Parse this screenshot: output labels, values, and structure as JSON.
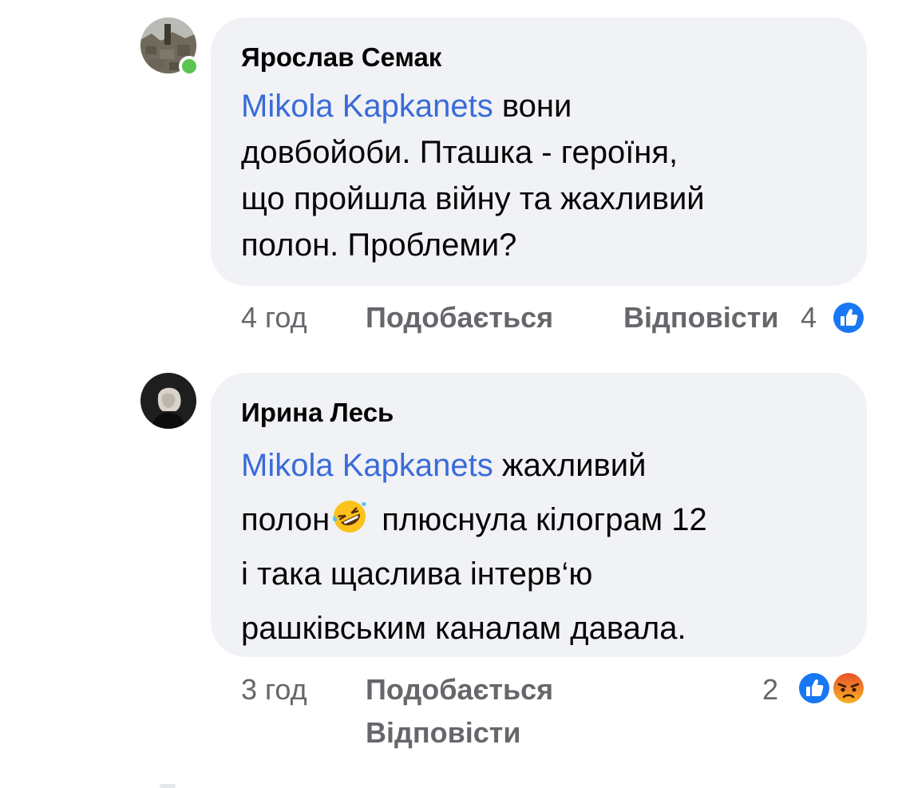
{
  "comments": [
    {
      "author": "Ярослав Семак",
      "online": true,
      "mention": "Mikola Kapkanets",
      "lines": [
        " вони",
        "довбойоби. Пташка - героїня,",
        "що пройшла війну та жахливий",
        "полон. Проблеми?"
      ],
      "time": "4 год",
      "like_label": "Подобається",
      "reply_label": "Відповісти",
      "reaction_count": "4",
      "reactions": [
        "like-icon"
      ]
    },
    {
      "author": "Ирина Лесь",
      "online": false,
      "mention": "Mikola Kapkanets",
      "line1_rest": " жахливий",
      "line2_before": "полон",
      "line2_after": " плюснула кілограм 12",
      "line3": "і така щаслива інтерв‘ю",
      "line4": "рашківським каналам давала.",
      "inline_emoji": "rolling-on-floor-laughing-emoji",
      "time": "3 год",
      "like_label": "Подобається",
      "reply_label": "Відповісти",
      "reaction_count": "2",
      "reactions": [
        "like-icon",
        "angry-face-icon"
      ]
    }
  ],
  "colors": {
    "mention": "#3a6bd8",
    "bubble": "#f0f2f5",
    "meta": "#65676b",
    "like_blue": "#1877f2",
    "online_green": "#5ac54f"
  }
}
